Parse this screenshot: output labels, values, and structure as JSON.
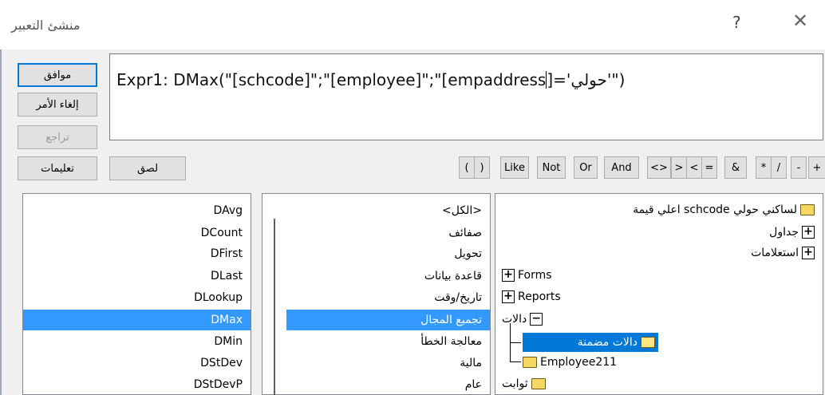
{
  "window": {
    "title": "منشئ التعبير",
    "help_symbol": "?",
    "close_symbol": "✕"
  },
  "buttons": {
    "ok": "موافق",
    "cancel": "إلغاء الأمر",
    "undo": "تراجع",
    "help": "تعليمات",
    "paste": "لصق"
  },
  "expression": {
    "before_caret": "Expr1: DMax(\"[schcode]\";\"[employee]\";\"[empaddress",
    "after_caret": "]='حولي'\")"
  },
  "operators": [
    "(",
    ")",
    "Like",
    "Not",
    "Or",
    "And",
    "<>",
    ">",
    "<",
    "=",
    "&",
    "*",
    "/",
    "-",
    "+"
  ],
  "functions_list": {
    "items": [
      "DAvg",
      "DCount",
      "DFirst",
      "DLast",
      "DLookup",
      "DMax",
      "DMin",
      "DStDev",
      "DStDevP"
    ],
    "selected": "DMax"
  },
  "categories_list": {
    "items": [
      "<الكل>",
      "صفائف",
      "تحويل",
      "قاعدة بيانات",
      "تاريخ/وقت",
      "تجميع المجال",
      "معالجة الخطأ",
      "مالية",
      "عام"
    ],
    "selected": "تجميع المجال"
  },
  "tree": {
    "items": [
      {
        "label": "لساكني حولي  schcode اعلي قيمة",
        "icon": "folder-icon"
      },
      {
        "label": "جداول",
        "icon": "plus-box-icon"
      },
      {
        "label": "استعلامات",
        "icon": "plus-box-icon"
      },
      {
        "label": "Forms",
        "icon": "plus-box-icon"
      },
      {
        "label": "Reports",
        "icon": "plus-box-icon"
      },
      {
        "label": "دالات",
        "icon": "minus-box-icon"
      },
      {
        "label": "دالات مضمنة",
        "icon": "open-folder-icon"
      },
      {
        "label": "Employee211",
        "icon": "folder-icon"
      },
      {
        "label": "ثوابت",
        "icon": "folder-icon"
      }
    ],
    "selected": "دالات مضمنة"
  },
  "colors": {
    "selection": "#3399ff",
    "tree_selection": "#0078d7",
    "default_button_border": "#0078d7"
  }
}
